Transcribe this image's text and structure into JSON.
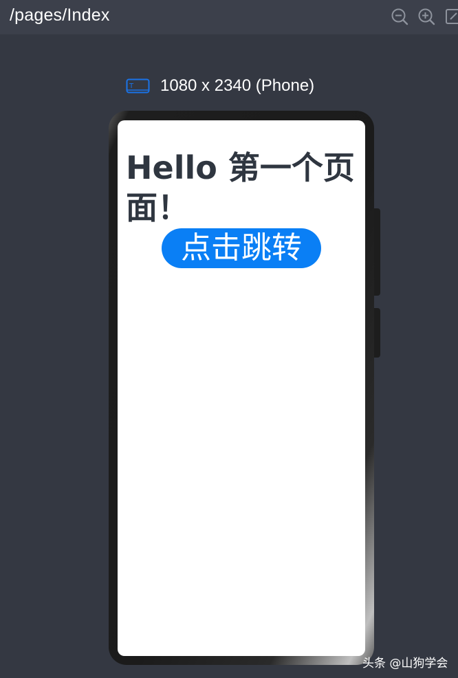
{
  "topbar": {
    "path": "/pages/Index",
    "zoom_out_icon": "zoom-out-icon",
    "zoom_in_icon": "zoom-in-icon",
    "fit_icon": "fit-screen-icon"
  },
  "device": {
    "icon": "tablet-device-icon",
    "icon_color": "#1a73e8",
    "label": "1080 x 2340 (Phone)"
  },
  "screen": {
    "heading": "Hello 第一个页面！",
    "button_label": "点击跳转",
    "button_color": "#0a7ff5"
  },
  "watermark": "头条 @山狗学会"
}
